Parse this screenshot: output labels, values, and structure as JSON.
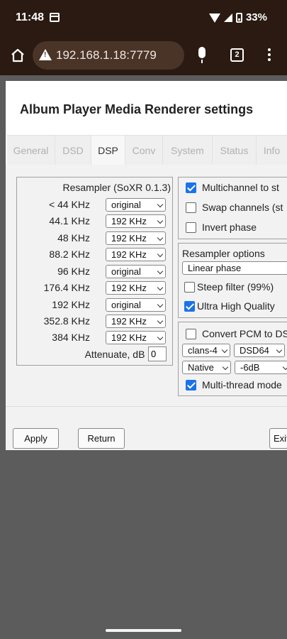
{
  "status_bar": {
    "time": "11:48",
    "battery": "33%"
  },
  "browser": {
    "url": "192.168.1.18:7779",
    "tab_count": "2"
  },
  "dialog": {
    "title": "Album Player Media Renderer settings",
    "tabs": [
      {
        "label": "General"
      },
      {
        "label": "DSD"
      },
      {
        "label": "DSP"
      },
      {
        "label": "Conv"
      },
      {
        "label": "System"
      },
      {
        "label": "Status"
      },
      {
        "label": "Info"
      }
    ],
    "active_tab": "DSP"
  },
  "resampler": {
    "title": "Resampler (SoXR 0.1.3)",
    "rows": [
      {
        "label": "< 44 KHz",
        "value": "original"
      },
      {
        "label": "44.1 KHz",
        "value": "192 KHz"
      },
      {
        "label": "48 KHz",
        "value": "192 KHz"
      },
      {
        "label": "88.2 KHz",
        "value": "192 KHz"
      },
      {
        "label": "96 KHz",
        "value": "original"
      },
      {
        "label": "176.4 KHz",
        "value": "192 KHz"
      },
      {
        "label": "192 KHz",
        "value": "original"
      },
      {
        "label": "352.8 KHz",
        "value": "192 KHz"
      },
      {
        "label": "384 KHz",
        "value": "192 KHz"
      }
    ],
    "attenuate_label": "Attenuate, dB -",
    "attenuate_value": "0"
  },
  "channel_options": {
    "multichannel": {
      "label": "Multichannel to st",
      "checked": true
    },
    "swap": {
      "label": "Swap channels (st",
      "checked": false
    },
    "invert": {
      "label": "Invert phase",
      "checked": false
    }
  },
  "resampler_options": {
    "title": "Resampler options",
    "phase": "Linear phase",
    "steep": {
      "label": "Steep filter (99%)",
      "checked": false
    },
    "uhq": {
      "label": "Ultra High Quality",
      "checked": true
    }
  },
  "pcm_to_dsd": {
    "convert": {
      "label": "Convert PCM to DS",
      "checked": false
    },
    "modulator": "clans-4",
    "dsd_rate": "DSD64",
    "mode": "Native",
    "gain": "-6dB",
    "multithread": {
      "label": "Multi-thread mode",
      "checked": true
    }
  },
  "buttons": {
    "apply": "Apply",
    "return": "Return",
    "exit": "Exit"
  }
}
